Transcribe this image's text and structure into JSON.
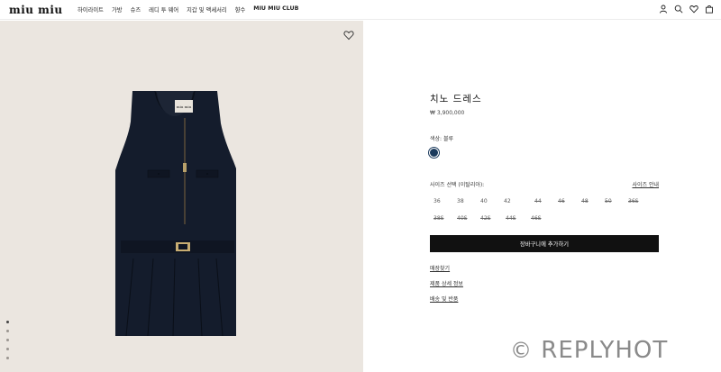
{
  "header": {
    "logo": "miu miu",
    "nav": [
      "하이라이트",
      "가방",
      "슈즈",
      "레디 투 웨어",
      "지갑 및 액세서리",
      "향수",
      "MIU MIU CLUB"
    ],
    "icons": [
      "user-icon",
      "search-icon",
      "heart-icon",
      "bag-icon"
    ]
  },
  "product": {
    "title": "치노 드레스",
    "price": "₩ 3,900,000",
    "color_label": "색상: 블루",
    "swatch_color": "#1b3a5c",
    "size_label": "사이즈 선택 (이탈리아):",
    "size_guide": "사이즈 안내",
    "sizes_row1": [
      {
        "label": "36",
        "available": true
      },
      {
        "label": "38",
        "available": true
      },
      {
        "label": "40",
        "available": true
      },
      {
        "label": "42",
        "available": true
      },
      {
        "label": "44",
        "available": false
      },
      {
        "label": "46",
        "available": false
      },
      {
        "label": "48",
        "available": false
      },
      {
        "label": "50",
        "available": false
      },
      {
        "label": "36S",
        "available": false
      }
    ],
    "sizes_row2": [
      {
        "label": "38S",
        "available": false
      },
      {
        "label": "40S",
        "available": false
      },
      {
        "label": "42S",
        "available": false
      },
      {
        "label": "44S",
        "available": false
      },
      {
        "label": "46S",
        "available": false
      }
    ],
    "cart_button": "장바구니에 추가하기",
    "links": [
      "매장찾기",
      "제품 상세 정보",
      "배송 및 반품"
    ]
  },
  "gallery": {
    "dot_count": 5,
    "active_index": 0
  },
  "watermark": {
    "symbol": "©",
    "text": "REPLYHOT"
  }
}
